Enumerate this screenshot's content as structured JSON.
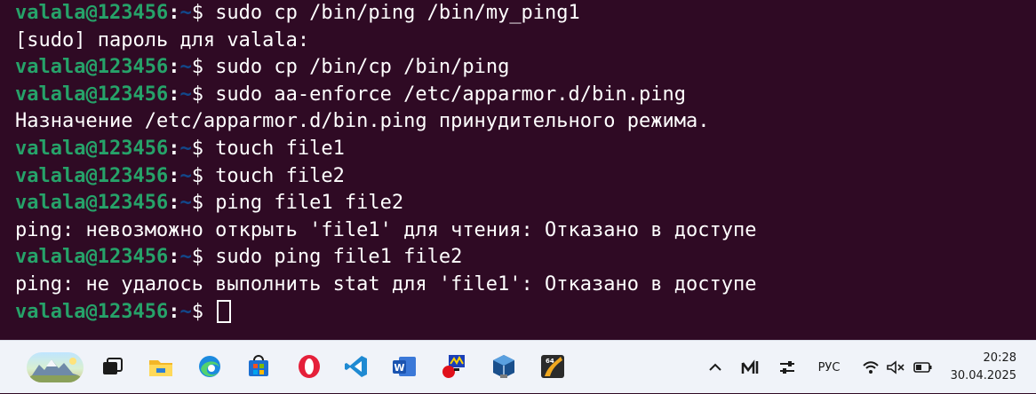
{
  "terminal": {
    "prompt": {
      "user": "valala@123456",
      "colon": ":",
      "path": "~",
      "dollar": "$ "
    },
    "lines": [
      {
        "type": "cmd",
        "text": "sudo cp /bin/ping /bin/my_ping1"
      },
      {
        "type": "out",
        "text": "[sudo] пароль для valala:"
      },
      {
        "type": "cmd",
        "text": "sudo cp /bin/cp /bin/ping"
      },
      {
        "type": "cmd",
        "text": "sudo aa-enforce /etc/apparmor.d/bin.ping"
      },
      {
        "type": "out",
        "text": "Назначение /etc/apparmor.d/bin.ping принудительного режима."
      },
      {
        "type": "cmd",
        "text": "touch file1"
      },
      {
        "type": "cmd",
        "text": "touch file2"
      },
      {
        "type": "cmd",
        "text": "ping file1 file2"
      },
      {
        "type": "out",
        "text": "ping: невозможно открыть 'file1' для чтения: Отказано в доступе"
      },
      {
        "type": "cmd",
        "text": "sudo ping file1 file2"
      },
      {
        "type": "out",
        "text": "ping: не удалось выполнить stat для 'file1': Отказано в доступе"
      },
      {
        "type": "cmd",
        "text": ""
      }
    ]
  },
  "taskbar": {
    "apps": [
      "widgets",
      "task-view",
      "file-explorer",
      "edge",
      "microsoft-store",
      "opera",
      "vscode",
      "word",
      "network-sim",
      "virtualbox",
      "x64dbg"
    ],
    "tray": {
      "language": "РУС",
      "time": "20:28",
      "date": "30.04.2025"
    }
  }
}
